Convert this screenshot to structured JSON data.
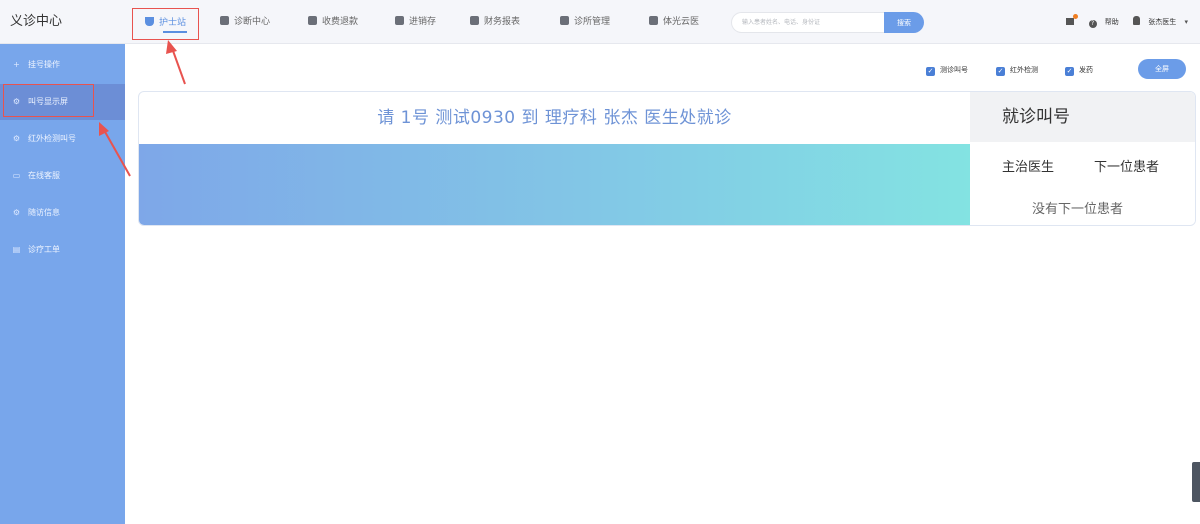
{
  "app": {
    "title": "义诊中心"
  },
  "nav": {
    "items": [
      {
        "label": "护士站",
        "icon": "shield-icon"
      },
      {
        "label": "诊断中心",
        "icon": "diagnosis-icon"
      },
      {
        "label": "收费退款",
        "icon": "payment-icon"
      },
      {
        "label": "进销存",
        "icon": "inventory-icon"
      },
      {
        "label": "财务报表",
        "icon": "report-icon"
      },
      {
        "label": "诊所管理",
        "icon": "clinic-icon"
      },
      {
        "label": "体光云医",
        "icon": "cloud-icon"
      }
    ]
  },
  "search": {
    "placeholder": "输入患者姓名、电话、身份证",
    "button": "搜索"
  },
  "header_tools": {
    "help": "帮助",
    "user": "张杰医生"
  },
  "sidebar": {
    "items": [
      {
        "label": "挂号操作",
        "icon": "plus-icon"
      },
      {
        "label": "叫号显示屏",
        "icon": "display-icon"
      },
      {
        "label": "红外检测叫号",
        "icon": "infrared-icon"
      },
      {
        "label": "在线客服",
        "icon": "chat-icon"
      },
      {
        "label": "随访信息",
        "icon": "followup-icon"
      },
      {
        "label": "诊疗工单",
        "icon": "ticket-icon"
      }
    ]
  },
  "toolbar": {
    "options": [
      "测诊叫号",
      "红外检测",
      "发药"
    ],
    "fullscreen": "全屏"
  },
  "call_screen": {
    "message": "请 1号 测试0930 到 理疗科 张杰 医生处就诊",
    "panel_title": "就诊叫号",
    "col_doctor": "主治医生",
    "col_next": "下一位患者",
    "empty": "没有下一位患者"
  },
  "colors": {
    "accent": "#6b9ce8",
    "sidebar": "#78a6eb",
    "annotation": "#e8534f"
  }
}
